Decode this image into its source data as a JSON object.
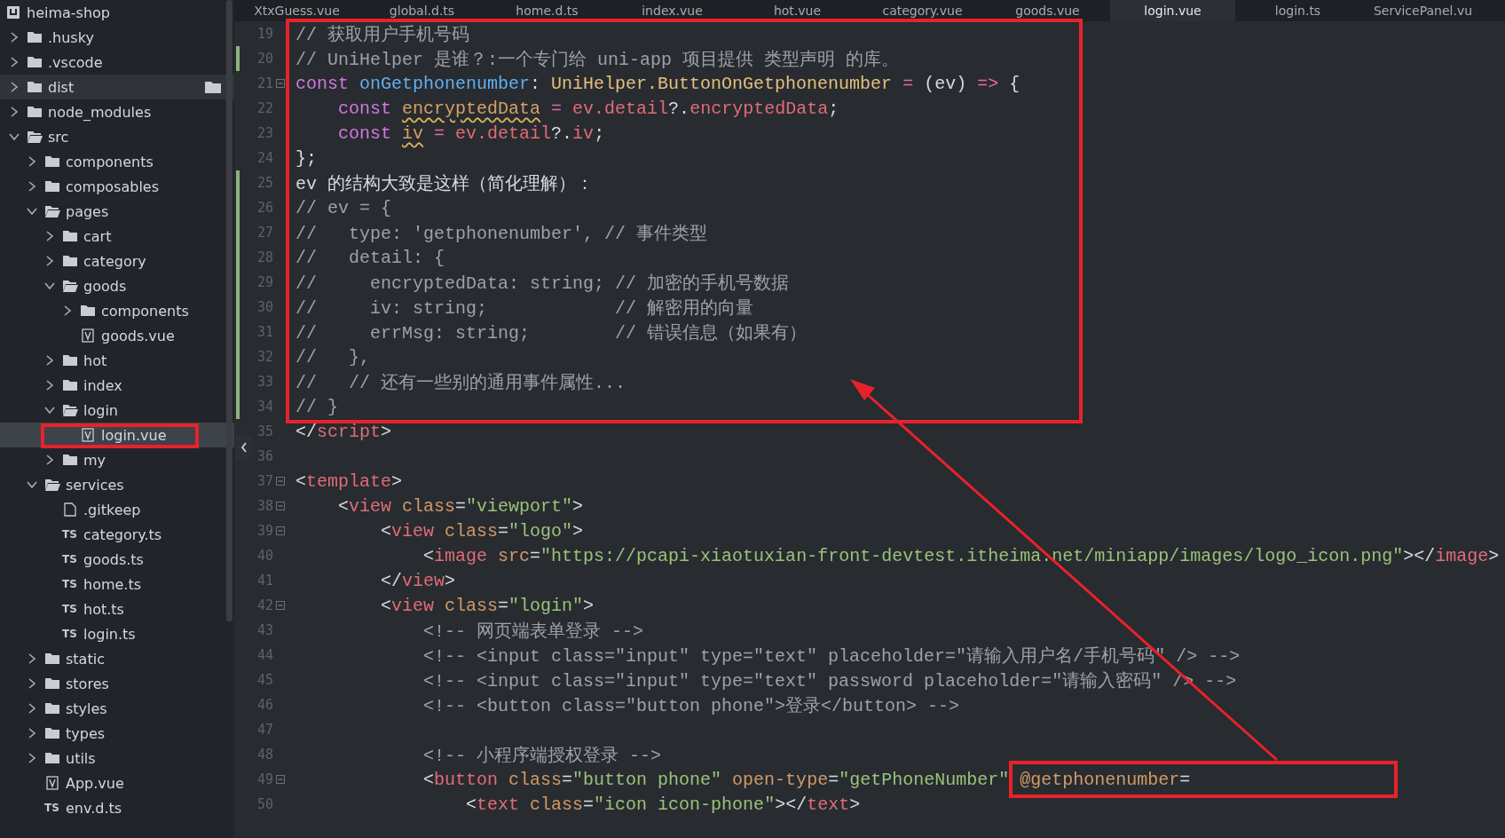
{
  "tabs": [
    {
      "label": "XtxGuess.vue",
      "selected": false
    },
    {
      "label": "global.d.ts",
      "selected": false
    },
    {
      "label": "home.d.ts",
      "selected": false
    },
    {
      "label": "index.vue",
      "selected": false
    },
    {
      "label": "hot.vue",
      "selected": false
    },
    {
      "label": "category.vue",
      "selected": false
    },
    {
      "label": "goods.vue",
      "selected": false
    },
    {
      "label": "login.vue",
      "selected": true
    },
    {
      "label": "login.ts",
      "selected": false
    },
    {
      "label": "ServicePanel.vu",
      "selected": false
    }
  ],
  "sidebar": {
    "project": "heima-shop",
    "items": [
      {
        "name": ".husky",
        "kind": "folder",
        "expanded": false,
        "selected": false,
        "hover": false
      },
      {
        "name": ".vscode",
        "kind": "folder",
        "expanded": false,
        "selected": false,
        "hover": false
      },
      {
        "name": "dist",
        "kind": "folder",
        "expanded": false,
        "selected": false,
        "hover": true
      },
      {
        "name": "node_modules",
        "kind": "folder",
        "expanded": false,
        "selected": false,
        "hover": false
      },
      {
        "name": "src",
        "kind": "folder",
        "expanded": true,
        "selected": false,
        "hover": false,
        "children": [
          {
            "name": "components",
            "kind": "folder",
            "expanded": false,
            "selected": false,
            "hover": false
          },
          {
            "name": "composables",
            "kind": "folder",
            "expanded": false,
            "selected": false,
            "hover": false
          },
          {
            "name": "pages",
            "kind": "folder",
            "expanded": true,
            "selected": false,
            "hover": false,
            "children": [
              {
                "name": "cart",
                "kind": "folder",
                "expanded": false,
                "selected": false,
                "hover": false
              },
              {
                "name": "category",
                "kind": "folder",
                "expanded": false,
                "selected": false,
                "hover": false
              },
              {
                "name": "goods",
                "kind": "folder",
                "expanded": true,
                "selected": false,
                "hover": false,
                "children": [
                  {
                    "name": "components",
                    "kind": "folder",
                    "expanded": false,
                    "selected": false,
                    "hover": false
                  },
                  {
                    "name": "goods.vue",
                    "kind": "vue",
                    "selected": false,
                    "hover": false
                  }
                ]
              },
              {
                "name": "hot",
                "kind": "folder",
                "expanded": false,
                "selected": false,
                "hover": false
              },
              {
                "name": "index",
                "kind": "folder",
                "expanded": false,
                "selected": false,
                "hover": false
              },
              {
                "name": "login",
                "kind": "folder",
                "expanded": true,
                "selected": false,
                "hover": false,
                "children": [
                  {
                    "name": "login.vue",
                    "kind": "vue",
                    "selected": true,
                    "hover": false
                  }
                ]
              },
              {
                "name": "my",
                "kind": "folder",
                "expanded": false,
                "selected": false,
                "hover": false
              }
            ]
          },
          {
            "name": "services",
            "kind": "folder",
            "expanded": true,
            "selected": false,
            "hover": false,
            "children": [
              {
                "name": ".gitkeep",
                "kind": "plain",
                "selected": false,
                "hover": false
              },
              {
                "name": "category.ts",
                "kind": "ts",
                "badge": "TS",
                "selected": false,
                "hover": false
              },
              {
                "name": "goods.ts",
                "kind": "ts",
                "badge": "TS",
                "selected": false,
                "hover": false
              },
              {
                "name": "home.ts",
                "kind": "ts",
                "badge": "TS",
                "selected": false,
                "hover": false
              },
              {
                "name": "hot.ts",
                "kind": "ts",
                "badge": "TS",
                "selected": false,
                "hover": false
              },
              {
                "name": "login.ts",
                "kind": "ts",
                "badge": "TS",
                "selected": false,
                "hover": false
              }
            ]
          },
          {
            "name": "static",
            "kind": "folder",
            "expanded": false,
            "selected": false,
            "hover": false
          },
          {
            "name": "stores",
            "kind": "folder",
            "expanded": false,
            "selected": false,
            "hover": false
          },
          {
            "name": "styles",
            "kind": "folder",
            "expanded": false,
            "selected": false,
            "hover": false
          },
          {
            "name": "types",
            "kind": "folder",
            "expanded": false,
            "selected": false,
            "hover": false
          },
          {
            "name": "utils",
            "kind": "folder",
            "expanded": false,
            "selected": false,
            "hover": false
          },
          {
            "name": "App.vue",
            "kind": "vue",
            "selected": false,
            "hover": false
          },
          {
            "name": "env.d.ts",
            "kind": "ts",
            "badge": "TS",
            "selected": false,
            "hover": false
          }
        ]
      }
    ]
  },
  "editor": {
    "lines": [
      {
        "number": "19",
        "fold": false,
        "modified": false,
        "tokens": [
          {
            "kind": "comment",
            "text": "// 获取用户手机号码"
          }
        ]
      },
      {
        "number": "20",
        "fold": false,
        "modified": true,
        "tokens": [
          {
            "kind": "comment",
            "text": "// UniHelper 是谁？:一个专门给 uni-app 项目提供 类型声明 的库。"
          }
        ]
      },
      {
        "number": "21",
        "fold": true,
        "modified": false,
        "tokens": [
          {
            "kind": "keyword",
            "text": "const "
          },
          {
            "kind": "function",
            "text": "onGetphonenumber"
          },
          {
            "kind": "plain",
            "text": ": "
          },
          {
            "kind": "type",
            "text": "UniHelper.ButtonOnGetphonenumber"
          },
          {
            "kind": "operator",
            "text": " = "
          },
          {
            "kind": "plain",
            "text": "(ev) "
          },
          {
            "kind": "operator",
            "text": "=>"
          },
          {
            "kind": "plain",
            "text": " {"
          }
        ]
      },
      {
        "number": "22",
        "fold": false,
        "modified": false,
        "tokens": [
          {
            "kind": "keyword",
            "text": "    const "
          },
          {
            "kind": "warning",
            "text": "encryptedData"
          },
          {
            "kind": "operator",
            "text": " = "
          },
          {
            "kind": "variable",
            "text": "ev.detail"
          },
          {
            "kind": "plain",
            "text": "?."
          },
          {
            "kind": "variable",
            "text": "encryptedData"
          },
          {
            "kind": "plain",
            "text": ";"
          }
        ]
      },
      {
        "number": "23",
        "fold": false,
        "modified": false,
        "tokens": [
          {
            "kind": "keyword",
            "text": "    const "
          },
          {
            "kind": "warning",
            "text": "iv"
          },
          {
            "kind": "operator",
            "text": " = "
          },
          {
            "kind": "variable",
            "text": "ev.detail"
          },
          {
            "kind": "plain",
            "text": "?."
          },
          {
            "kind": "variable",
            "text": "iv"
          },
          {
            "kind": "plain",
            "text": ";"
          }
        ]
      },
      {
        "number": "24",
        "fold": false,
        "modified": false,
        "tokens": [
          {
            "kind": "plain",
            "text": "};"
          }
        ]
      },
      {
        "number": "25",
        "fold": false,
        "modified": true,
        "tokens": [
          {
            "kind": "plain",
            "text": "ev 的结构大致是这样（简化理解）："
          }
        ]
      },
      {
        "number": "26",
        "fold": false,
        "modified": true,
        "tokens": [
          {
            "kind": "comment",
            "text": "// ev = {"
          }
        ]
      },
      {
        "number": "27",
        "fold": false,
        "modified": true,
        "tokens": [
          {
            "kind": "comment",
            "text": "//   type: 'getphonenumber', // 事件类型"
          }
        ]
      },
      {
        "number": "28",
        "fold": false,
        "modified": true,
        "tokens": [
          {
            "kind": "comment",
            "text": "//   detail: {"
          }
        ]
      },
      {
        "number": "29",
        "fold": false,
        "modified": true,
        "tokens": [
          {
            "kind": "comment",
            "text": "//     encryptedData: string; // 加密的手机号数据"
          }
        ]
      },
      {
        "number": "30",
        "fold": false,
        "modified": true,
        "tokens": [
          {
            "kind": "comment",
            "text": "//     iv: string;            // 解密用的向量"
          }
        ]
      },
      {
        "number": "31",
        "fold": false,
        "modified": true,
        "tokens": [
          {
            "kind": "comment",
            "text": "//     errMsg: string;        // 错误信息（如果有）"
          }
        ]
      },
      {
        "number": "32",
        "fold": false,
        "modified": true,
        "tokens": [
          {
            "kind": "comment",
            "text": "//   },"
          }
        ]
      },
      {
        "number": "33",
        "fold": false,
        "modified": true,
        "tokens": [
          {
            "kind": "comment",
            "text": "//   // 还有一些别的通用事件属性..."
          }
        ]
      },
      {
        "number": "34",
        "fold": false,
        "modified": true,
        "tokens": [
          {
            "kind": "comment",
            "text": "// }"
          }
        ]
      },
      {
        "number": "35",
        "fold": false,
        "modified": false,
        "tokens": [
          {
            "kind": "plain",
            "text": "</"
          },
          {
            "kind": "tag",
            "text": "script"
          },
          {
            "kind": "plain",
            "text": ">"
          }
        ]
      },
      {
        "number": "36",
        "fold": false,
        "modified": false
      },
      {
        "number": "37",
        "fold": true,
        "modified": false,
        "tokens": [
          {
            "kind": "plain",
            "text": "<"
          },
          {
            "kind": "tag",
            "text": "template"
          },
          {
            "kind": "plain",
            "text": ">"
          }
        ]
      },
      {
        "number": "38",
        "fold": true,
        "modified": false,
        "tokens": [
          {
            "kind": "plain",
            "text": "    <"
          },
          {
            "kind": "tag",
            "text": "view"
          },
          {
            "kind": "attribute",
            "text": " class"
          },
          {
            "kind": "plain",
            "text": "="
          },
          {
            "kind": "string",
            "text": "\"viewport\""
          },
          {
            "kind": "plain",
            "text": ">"
          }
        ]
      },
      {
        "number": "39",
        "fold": true,
        "modified": false,
        "tokens": [
          {
            "kind": "plain",
            "text": "        <"
          },
          {
            "kind": "tag",
            "text": "view"
          },
          {
            "kind": "attribute",
            "text": " class"
          },
          {
            "kind": "plain",
            "text": "="
          },
          {
            "kind": "string",
            "text": "\"logo\""
          },
          {
            "kind": "plain",
            "text": ">"
          }
        ]
      },
      {
        "number": "40",
        "fold": false,
        "modified": false,
        "tokens": [
          {
            "kind": "plain",
            "text": "            <"
          },
          {
            "kind": "tag",
            "text": "image"
          },
          {
            "kind": "attribute",
            "text": " src"
          },
          {
            "kind": "plain",
            "text": "="
          },
          {
            "kind": "string",
            "text": "\"https://pcapi-xiaotuxian-front-devtest.itheima.net/miniapp/images/logo_icon.png\""
          },
          {
            "kind": "plain",
            "text": "></"
          },
          {
            "kind": "tag",
            "text": "image"
          },
          {
            "kind": "plain",
            "text": ">"
          }
        ]
      },
      {
        "number": "41",
        "fold": false,
        "modified": false,
        "tokens": [
          {
            "kind": "plain",
            "text": "        </"
          },
          {
            "kind": "tag",
            "text": "view"
          },
          {
            "kind": "plain",
            "text": ">"
          }
        ]
      },
      {
        "number": "42",
        "fold": true,
        "modified": false,
        "tokens": [
          {
            "kind": "plain",
            "text": "        <"
          },
          {
            "kind": "tag",
            "text": "view"
          },
          {
            "kind": "attribute",
            "text": " class"
          },
          {
            "kind": "plain",
            "text": "="
          },
          {
            "kind": "string",
            "text": "\"login\""
          },
          {
            "kind": "plain",
            "text": ">"
          }
        ]
      },
      {
        "number": "43",
        "fold": false,
        "modified": false,
        "tokens": [
          {
            "kind": "comment",
            "text": "            <!-- 网页端表单登录 -->"
          }
        ]
      },
      {
        "number": "44",
        "fold": false,
        "modified": false,
        "tokens": [
          {
            "kind": "comment",
            "text": "            <!-- <input class=\"input\" type=\"text\" placeholder=\"请输入用户名/手机号码\" /> -->"
          }
        ]
      },
      {
        "number": "45",
        "fold": false,
        "modified": false,
        "tokens": [
          {
            "kind": "comment",
            "text": "            <!-- <input class=\"input\" type=\"text\" password placeholder=\"请输入密码\" /> -->"
          }
        ]
      },
      {
        "number": "46",
        "fold": false,
        "modified": false,
        "tokens": [
          {
            "kind": "comment",
            "text": "            <!-- <button class=\"button phone\">登录</button> -->"
          }
        ]
      },
      {
        "number": "47",
        "fold": false,
        "modified": false
      },
      {
        "number": "48",
        "fold": false,
        "modified": false,
        "tokens": [
          {
            "kind": "comment",
            "text": "            <!-- 小程序端授权登录 -->"
          }
        ]
      },
      {
        "number": "49",
        "fold": true,
        "modified": false,
        "tokens": [
          {
            "kind": "plain",
            "text": "            <"
          },
          {
            "kind": "tag",
            "text": "button"
          },
          {
            "kind": "attribute",
            "text": " class"
          },
          {
            "kind": "plain",
            "text": "="
          },
          {
            "kind": "string",
            "text": "\"button phone\""
          },
          {
            "kind": "attribute",
            "text": " open-type"
          },
          {
            "kind": "plain",
            "text": "="
          },
          {
            "kind": "string",
            "text": "\"getPhoneNumber\""
          },
          {
            "kind": "attribute",
            "text": " @getphonenumber"
          },
          {
            "kind": "plain",
            "text": "="
          }
        ]
      },
      {
        "number": "50",
        "fold": false,
        "modified": false,
        "tokens": [
          {
            "kind": "plain",
            "text": "                <"
          },
          {
            "kind": "tag",
            "text": "text"
          },
          {
            "kind": "attribute",
            "text": " class"
          },
          {
            "kind": "plain",
            "text": "="
          },
          {
            "kind": "string",
            "text": "\"icon icon-phone\""
          },
          {
            "kind": "plain",
            "text": "></"
          },
          {
            "kind": "tag",
            "text": "text"
          },
          {
            "kind": "plain",
            "text": ">"
          }
        ]
      }
    ]
  }
}
